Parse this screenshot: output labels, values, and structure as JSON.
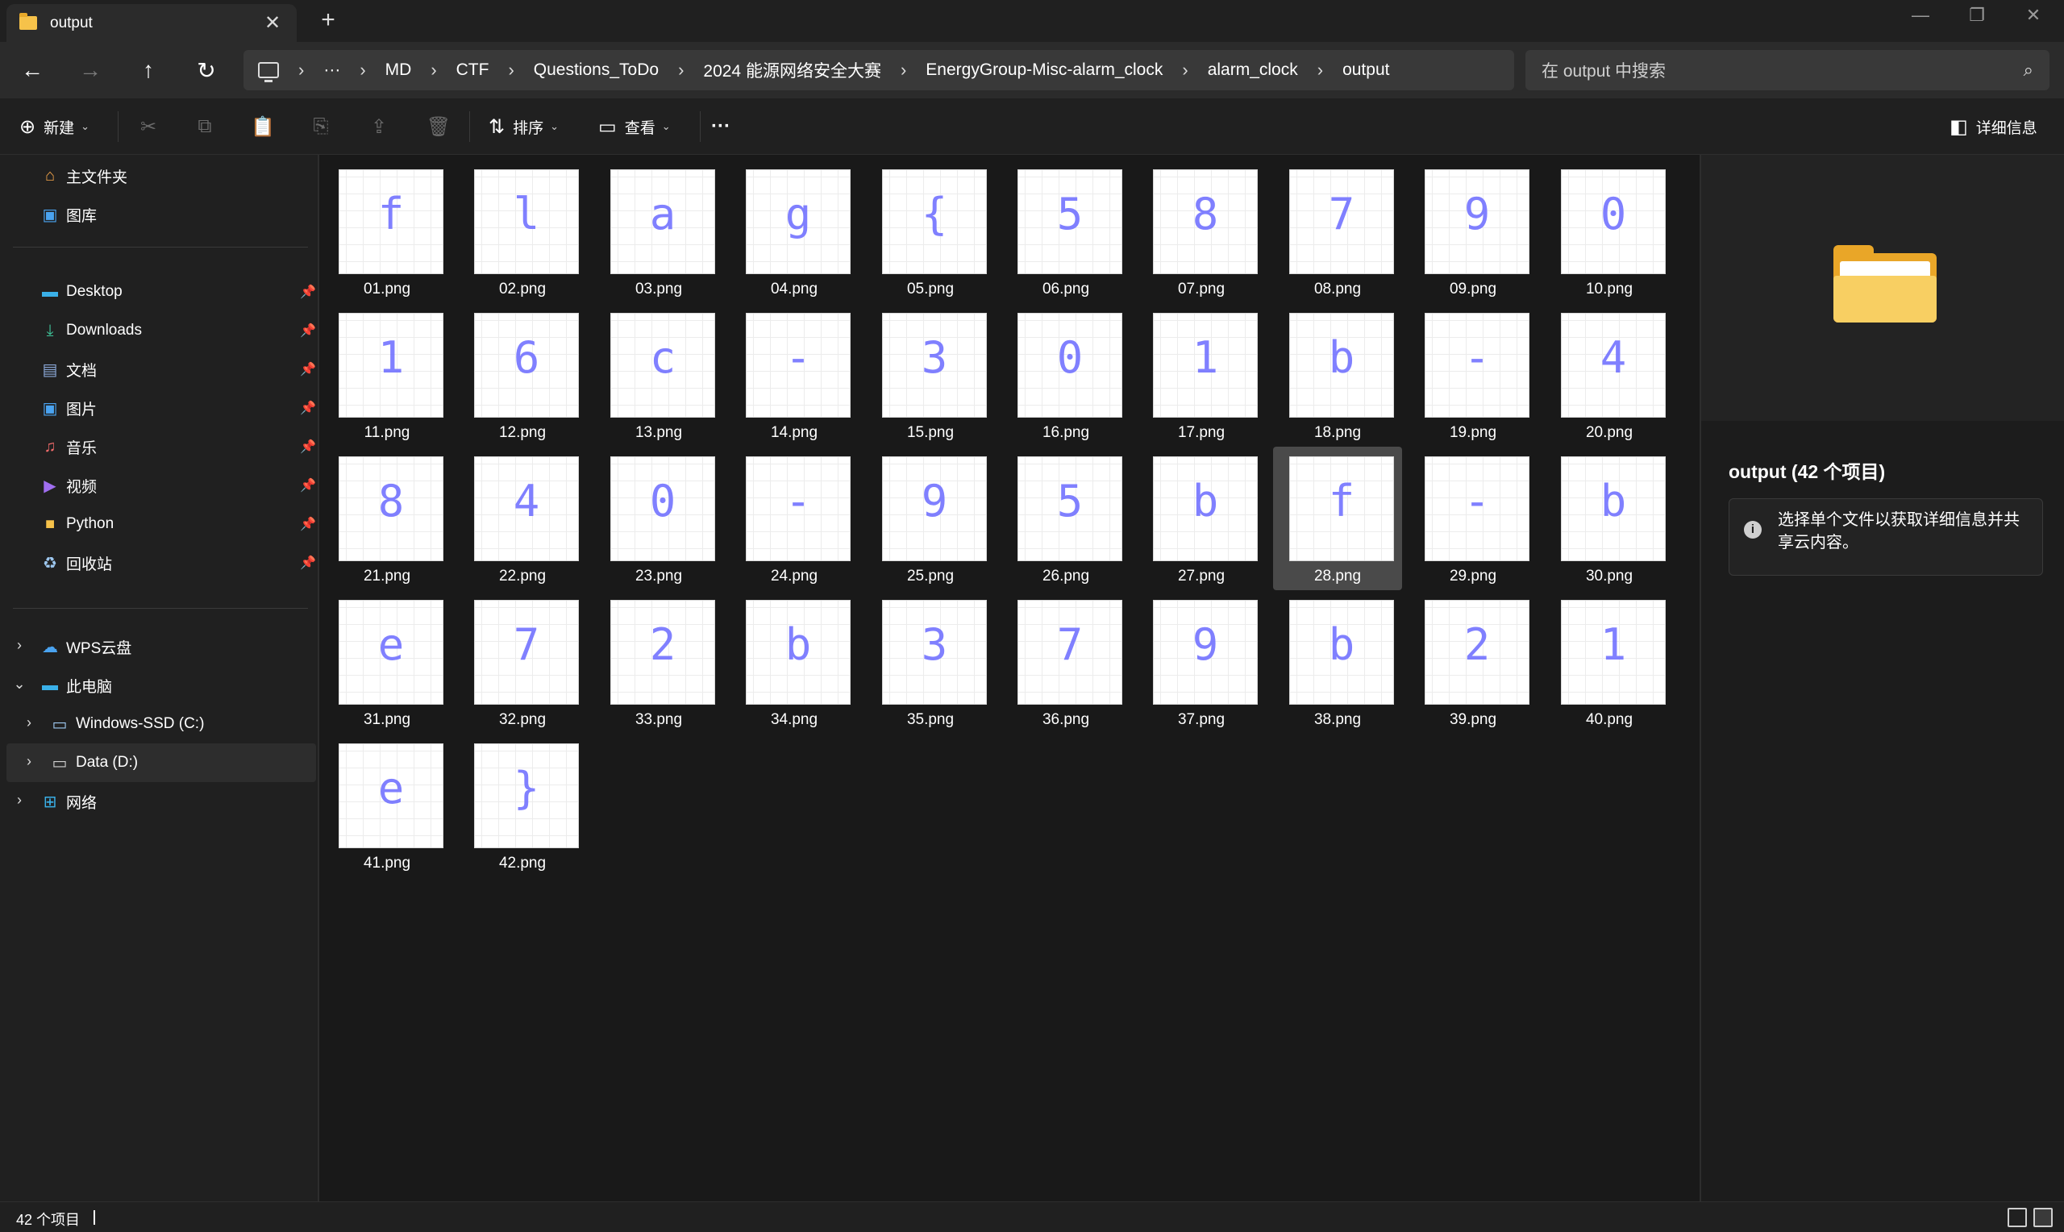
{
  "window": {
    "tab_title": "output",
    "tab_close": "✕",
    "new_tab": "+",
    "minimize": "—",
    "restore": "❐",
    "close": "✕"
  },
  "nav": {
    "back": "←",
    "forward": "→",
    "up": "↑",
    "refresh": "↻",
    "overflow": "···",
    "breadcrumbs": [
      "MD",
      "CTF",
      "Questions_ToDo",
      "2024 能源网络安全大赛",
      "EnergyGroup-Misc-alarm_clock",
      "alarm_clock",
      "output"
    ],
    "separator": "›",
    "search_placeholder": "在 output 中搜索"
  },
  "toolbar": {
    "new_label": "新建",
    "sort_label": "排序",
    "view_label": "查看",
    "more_label": "···",
    "details_label": "详细信息"
  },
  "sidebar": {
    "home": "主文件夹",
    "gallery": "图库",
    "pinned": [
      "Desktop",
      "Downloads",
      "文档",
      "图片",
      "音乐",
      "视频",
      "Python",
      "回收站"
    ],
    "wps": "WPS云盘",
    "this_pc": "此电脑",
    "drive_c": "Windows-SSD (C:)",
    "drive_d": "Data (D:)",
    "network": "网络"
  },
  "files": [
    {
      "name": "01.png",
      "glyph": "f"
    },
    {
      "name": "02.png",
      "glyph": "l"
    },
    {
      "name": "03.png",
      "glyph": "a"
    },
    {
      "name": "04.png",
      "glyph": "g"
    },
    {
      "name": "05.png",
      "glyph": "{"
    },
    {
      "name": "06.png",
      "glyph": "5"
    },
    {
      "name": "07.png",
      "glyph": "8"
    },
    {
      "name": "08.png",
      "glyph": "7"
    },
    {
      "name": "09.png",
      "glyph": "9"
    },
    {
      "name": "10.png",
      "glyph": "0"
    },
    {
      "name": "11.png",
      "glyph": "1"
    },
    {
      "name": "12.png",
      "glyph": "6"
    },
    {
      "name": "13.png",
      "glyph": "c"
    },
    {
      "name": "14.png",
      "glyph": "-"
    },
    {
      "name": "15.png",
      "glyph": "3"
    },
    {
      "name": "16.png",
      "glyph": "0"
    },
    {
      "name": "17.png",
      "glyph": "1"
    },
    {
      "name": "18.png",
      "glyph": "b"
    },
    {
      "name": "19.png",
      "glyph": "-"
    },
    {
      "name": "20.png",
      "glyph": "4"
    },
    {
      "name": "21.png",
      "glyph": "8"
    },
    {
      "name": "22.png",
      "glyph": "4"
    },
    {
      "name": "23.png",
      "glyph": "0"
    },
    {
      "name": "24.png",
      "glyph": "-"
    },
    {
      "name": "25.png",
      "glyph": "9"
    },
    {
      "name": "26.png",
      "glyph": "5"
    },
    {
      "name": "27.png",
      "glyph": "b"
    },
    {
      "name": "28.png",
      "glyph": "f"
    },
    {
      "name": "29.png",
      "glyph": "-"
    },
    {
      "name": "30.png",
      "glyph": "b"
    },
    {
      "name": "31.png",
      "glyph": "e"
    },
    {
      "name": "32.png",
      "glyph": "7"
    },
    {
      "name": "33.png",
      "glyph": "2"
    },
    {
      "name": "34.png",
      "glyph": "b"
    },
    {
      "name": "35.png",
      "glyph": "3"
    },
    {
      "name": "36.png",
      "glyph": "7"
    },
    {
      "name": "37.png",
      "glyph": "9"
    },
    {
      "name": "38.png",
      "glyph": "b"
    },
    {
      "name": "39.png",
      "glyph": "2"
    },
    {
      "name": "40.png",
      "glyph": "1"
    },
    {
      "name": "41.png",
      "glyph": "e"
    },
    {
      "name": "42.png",
      "glyph": "}"
    }
  ],
  "selected_file": "28.png",
  "details": {
    "title": "output (42 个项目)",
    "info": "选择单个文件以获取详细信息并共享云内容。"
  },
  "status": {
    "count": "42 个项目"
  },
  "colors": {
    "accent_folder": "#f6c24a",
    "glyph_stroke": "#6b6bff",
    "background": "#191919"
  }
}
